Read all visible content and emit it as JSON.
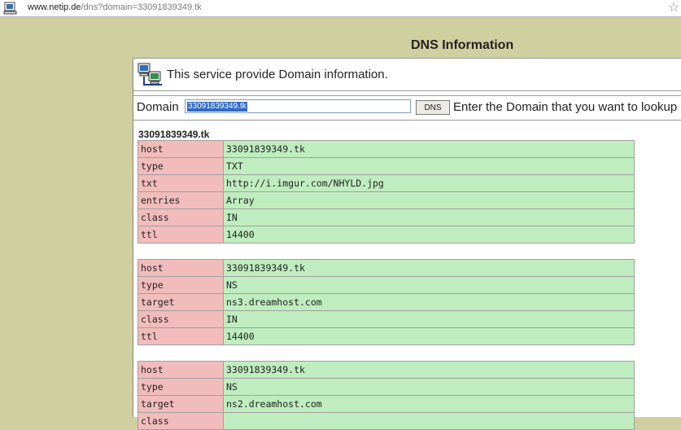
{
  "address_bar": {
    "url_host": "www.netip.de",
    "url_path": "/dns?domain=33091839349.tk"
  },
  "page_title": "DNS Information",
  "service_text": "This service provide Domain information.",
  "form": {
    "label": "Domain",
    "input_value": "33091839349.tk",
    "button_label": "DNS",
    "hint": "Enter the Domain that you want to lookup"
  },
  "domain_heading": "33091839349.tk",
  "records": [
    {
      "rows": [
        {
          "key": "host",
          "value": "33091839349.tk"
        },
        {
          "key": "type",
          "value": "TXT"
        },
        {
          "key": "txt",
          "value": "http://i.imgur.com/NHYLD.jpg"
        },
        {
          "key": "entries",
          "value": "Array"
        },
        {
          "key": "class",
          "value": "IN"
        },
        {
          "key": "ttl",
          "value": "14400"
        }
      ]
    },
    {
      "rows": [
        {
          "key": "host",
          "value": "33091839349.tk"
        },
        {
          "key": "type",
          "value": "NS"
        },
        {
          "key": "target",
          "value": "ns3.dreamhost.com"
        },
        {
          "key": "class",
          "value": "IN"
        },
        {
          "key": "ttl",
          "value": "14400"
        }
      ]
    },
    {
      "rows": [
        {
          "key": "host",
          "value": "33091839349.tk"
        },
        {
          "key": "type",
          "value": "NS"
        },
        {
          "key": "target",
          "value": "ns2.dreamhost.com"
        },
        {
          "key": "class",
          "value": ""
        }
      ]
    }
  ],
  "icons": {
    "page": "page-icon",
    "bookmark": "star-icon",
    "service": "computer-network-icon"
  },
  "colors": {
    "page_background": "#cfcf9f",
    "key_cell": "#f2bcbc",
    "value_cell": "#bfedbf",
    "selection": "#316ac5"
  }
}
